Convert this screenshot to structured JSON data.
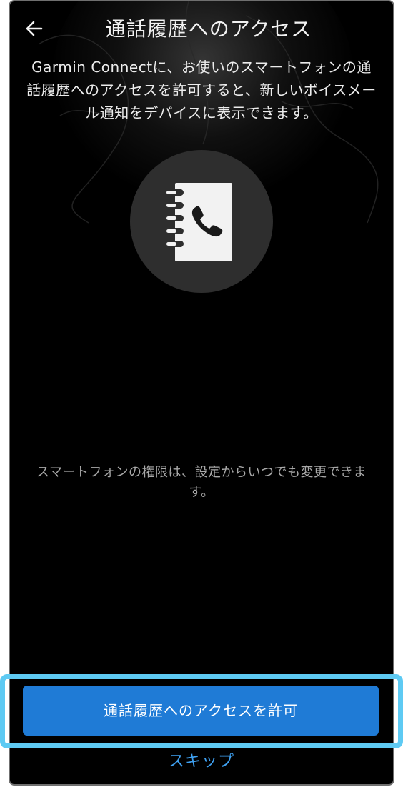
{
  "header": {
    "back_icon": "arrow-left-icon",
    "title": "通話履歴へのアクセス"
  },
  "content": {
    "description": "Garmin Connectに、お使いのスマートフォンの通話履歴へのアクセスを許可すると、新しいボイスメール通知をデバイスに表示できます。",
    "icon": "call-log-notebook-phone-icon",
    "permission_note": "スマートフォンの権限は、設定からいつでも変更できます。"
  },
  "actions": {
    "allow_label": "通話履歴へのアクセスを許可",
    "skip_label": "スキップ"
  },
  "colors": {
    "background": "#000000",
    "primary_button": "#1f7bd6",
    "skip_link": "#3fa0f0",
    "highlight": "#5ecaf3",
    "icon_circle": "#2e2e2e"
  }
}
